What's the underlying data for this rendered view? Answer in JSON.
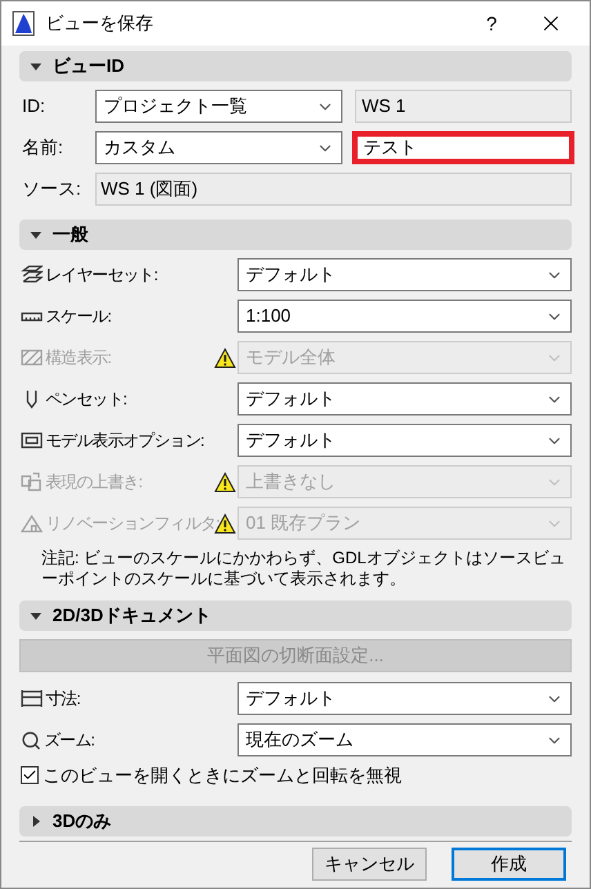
{
  "window": {
    "title": "ビューを保存",
    "help": "?"
  },
  "view_id": {
    "header": {
      "title": "ビューID",
      "expanded": true
    },
    "rows": [
      {
        "label": "ID:",
        "dropdown": "プロジェクト一覧",
        "text": "WS 1",
        "editable": false,
        "highlighted": false
      },
      {
        "label": "名前:",
        "dropdown": "カスタム",
        "text": "テスト",
        "editable": true,
        "highlighted": true
      }
    ],
    "source": {
      "label": "ソース:",
      "value": "WS 1 (図面)"
    }
  },
  "general": {
    "header": {
      "title": "一般",
      "expanded": true
    },
    "rows": [
      {
        "kind": "layers",
        "label": "レイヤーセット:",
        "value": "デフォルト",
        "disabled": false,
        "warning": false
      },
      {
        "kind": "ruler",
        "label": "スケール:",
        "value": "1:100",
        "disabled": false,
        "warning": false
      },
      {
        "kind": "structure",
        "label": "構造表示:",
        "value": "モデル全体",
        "disabled": true,
        "warning": true
      },
      {
        "kind": "pen",
        "label": "ペンセット:",
        "value": "デフォルト",
        "disabled": false,
        "warning": false
      },
      {
        "kind": "model",
        "label": "モデル表示オプション:",
        "value": "デフォルト",
        "disabled": false,
        "warning": false
      },
      {
        "kind": "override",
        "label": "表現の上書き:",
        "value": "上書きなし",
        "disabled": true,
        "warning": true
      },
      {
        "kind": "renovation",
        "label": "リノベーションフィルタ:",
        "value": "01 既存プラン",
        "disabled": true,
        "warning": true
      }
    ],
    "note": "注記: ビューのスケールにかかわらず、GDLオブジェクトはソースビューポイントのスケールに基づいて表示されます。"
  },
  "documents": {
    "header": {
      "title": "2D/3Dドキュメント",
      "expanded": true
    },
    "button": {
      "label": "平面図の切断面設定...",
      "disabled": true
    },
    "rows": [
      {
        "kind": "dimension",
        "label": "寸法:",
        "value": "デフォルト",
        "disabled": false,
        "warning": false
      },
      {
        "kind": "zoom",
        "label": "ズーム:",
        "value": "現在のズーム",
        "disabled": false,
        "warning": false
      }
    ],
    "checkbox": {
      "label": "このビューを開くときにズームと回転を無視",
      "checked": true
    }
  },
  "only_3d": {
    "header": {
      "title": "3Dのみ",
      "expanded": false
    }
  },
  "buttons": [
    {
      "label": "キャンセル",
      "default": false
    },
    {
      "label": "作成",
      "default": true
    }
  ]
}
